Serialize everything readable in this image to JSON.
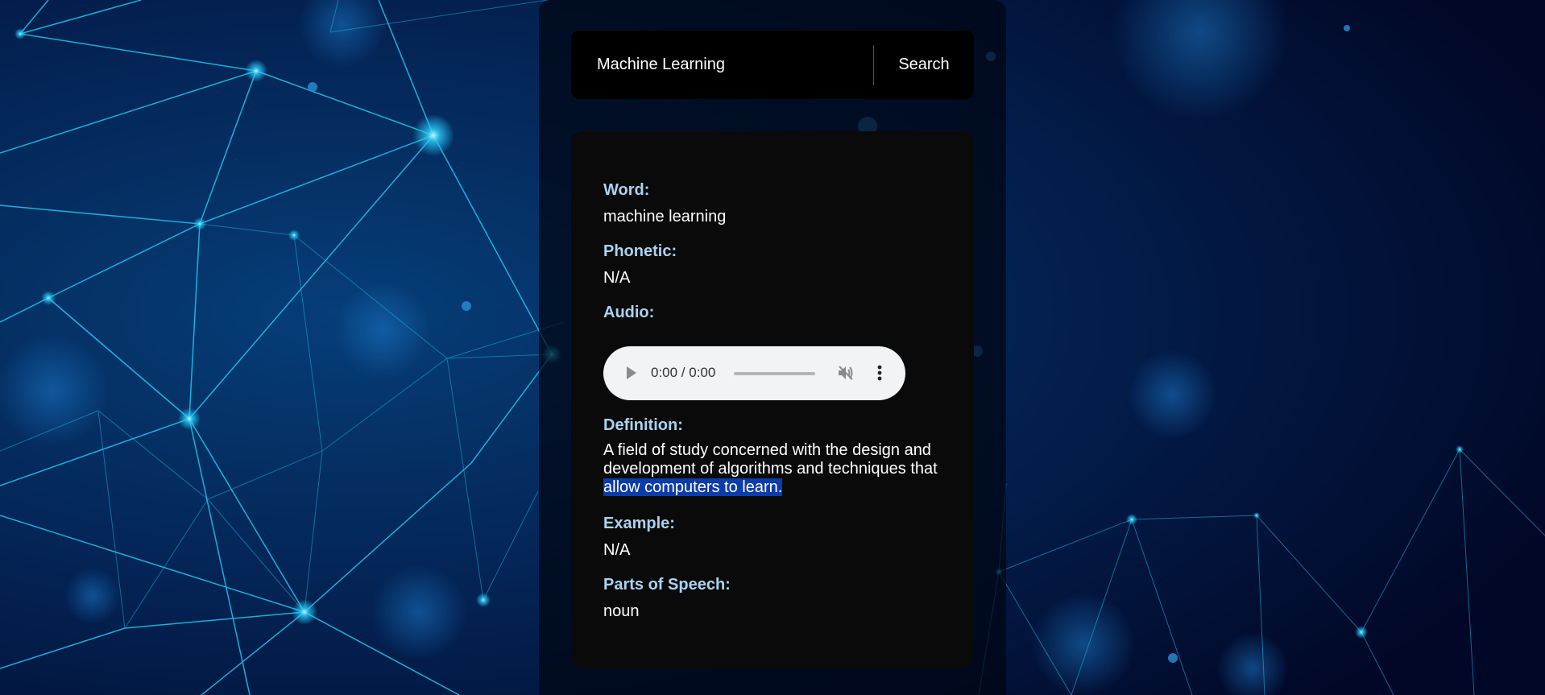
{
  "search": {
    "input_value": "Machine Learning",
    "button_label": "Search"
  },
  "result": {
    "word_label": "Word:",
    "word_value": "machine learning",
    "phonetic_label": "Phonetic:",
    "phonetic_value": "N/A",
    "audio_label": "Audio:",
    "audio_time": "0:00 / 0:00",
    "definition_label": "Definition:",
    "definition_line1": "A field of study concerned with the design and",
    "definition_line2": "development of algorithms and techniques that",
    "definition_line3_selected": "allow computers to learn.",
    "example_label": "Example:",
    "example_value": "N/A",
    "pos_label": "Parts of Speech:",
    "pos_value": "noun"
  },
  "colors": {
    "label": "#a9d3ee",
    "card_background": "#0a0a0a",
    "selection": "#0d3ba8",
    "network_line": "#1ec8f0"
  },
  "icons": {
    "play": "play-icon",
    "volume": "volume-icon",
    "more": "more-vertical-icon"
  }
}
